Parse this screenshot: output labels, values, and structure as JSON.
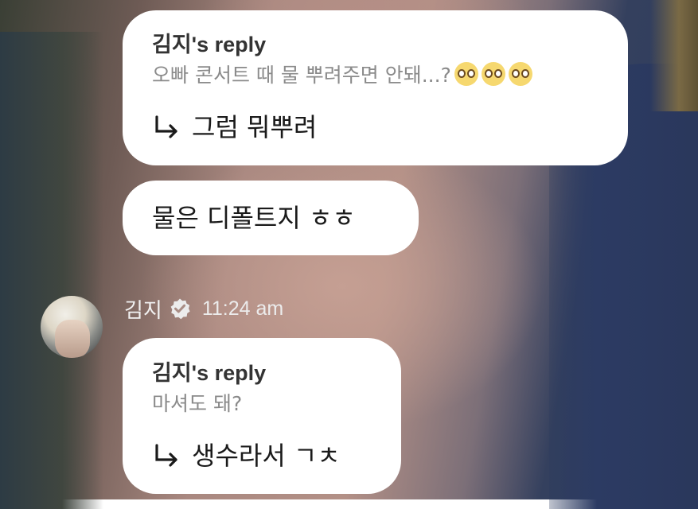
{
  "messages": [
    {
      "reply_label": "김지's reply",
      "quoted": "오빠 콘서트 때 물 뿌려주면 안돼...?",
      "quoted_emojis": [
        "pleading-face-emoji",
        "pleading-face-emoji",
        "pleading-face-emoji"
      ],
      "answer": "그럼 뭐뿌려"
    },
    {
      "text": "물은 디폴트지 ㅎㅎ"
    },
    {
      "sender": {
        "name": "김지",
        "verified_icon": "verified-badge-icon",
        "time": "11:24 am"
      },
      "reply_label": "김지's reply",
      "quoted": "마셔도 돼?",
      "answer": "생수라서 ㄱㅊ"
    }
  ],
  "colors": {
    "bubble": "#ffffff",
    "reply_label": "#333333",
    "quoted_text": "#8a8a8a",
    "answer_text": "#1a1a1a",
    "meta_text": "#f2f2f2"
  }
}
